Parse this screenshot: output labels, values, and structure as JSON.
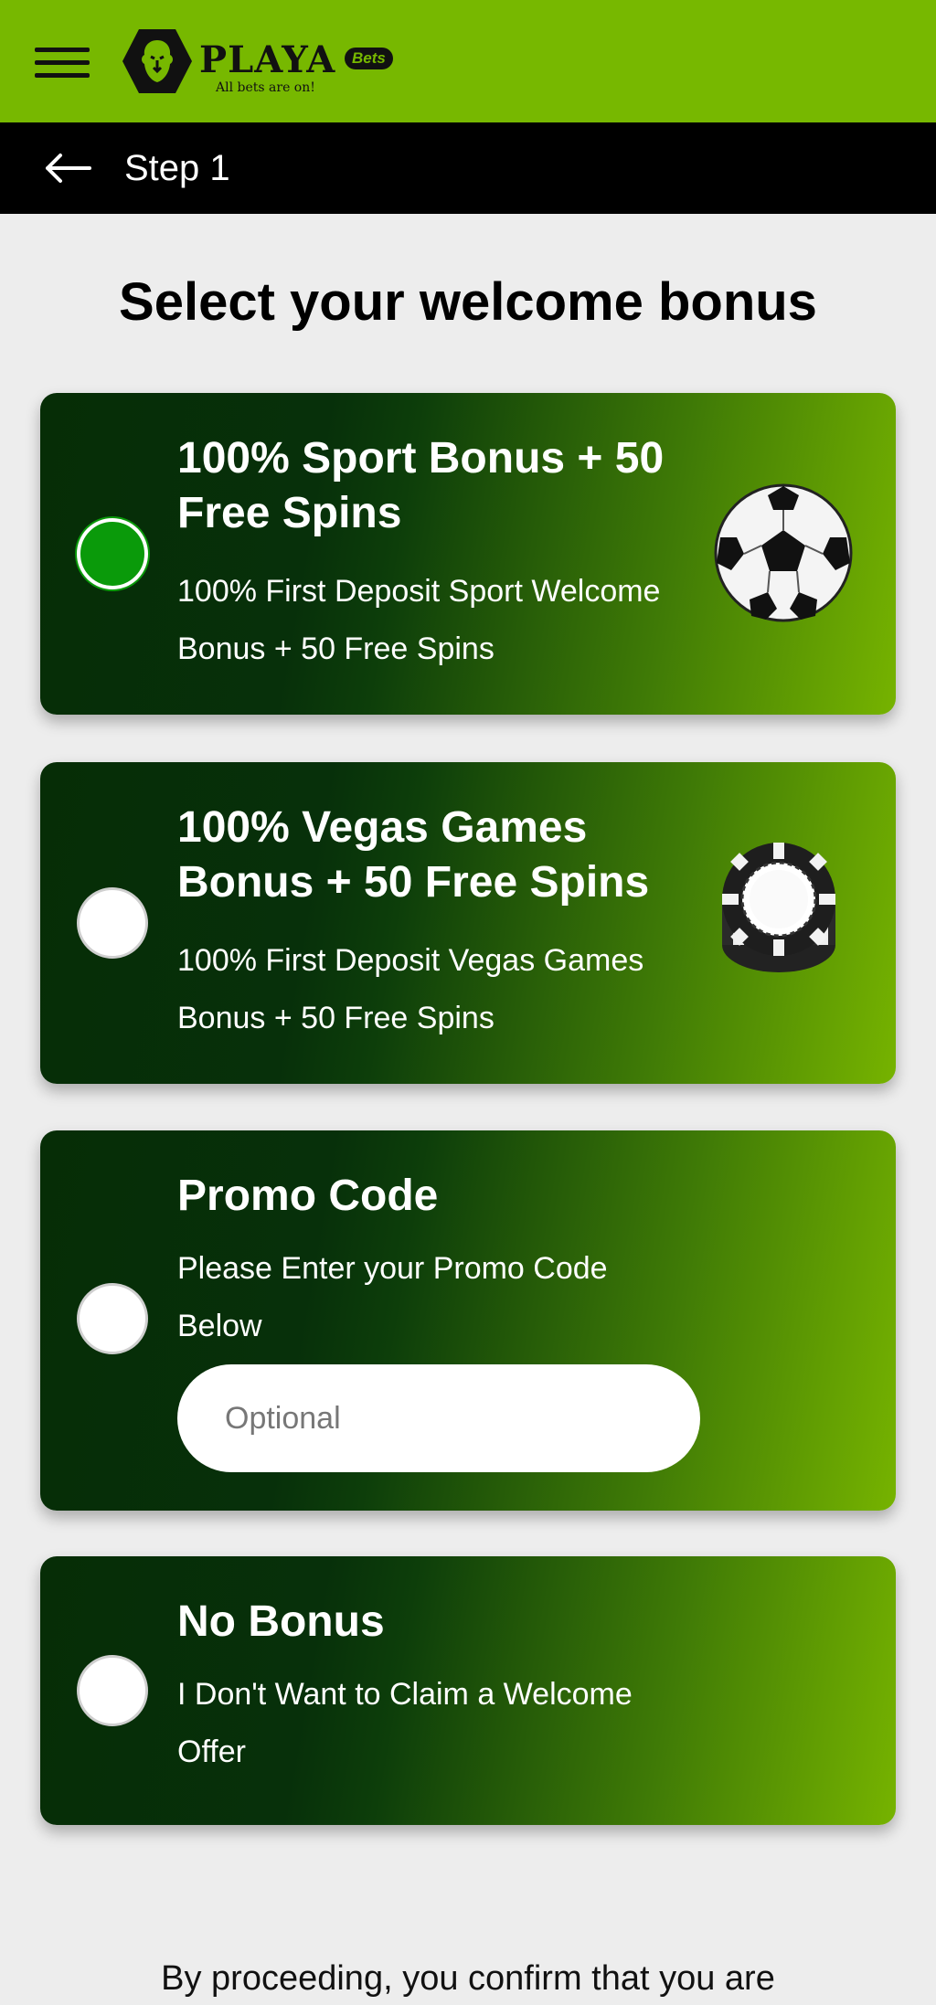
{
  "header": {
    "logo_word": "PLAYA",
    "logo_badge": "Bets",
    "logo_tagline": "All bets are on!",
    "menu_icon": "hamburger-menu-icon",
    "brand_color": "#77b800"
  },
  "step_bar": {
    "back_icon": "arrow-left-icon",
    "title": "Step 1"
  },
  "page": {
    "heading": "Select your welcome bonus"
  },
  "bonus_options": [
    {
      "title_line1": "100% Sport Bonus + 50",
      "title_line2": "Free Spins",
      "desc_line1": "100% First Deposit Sport Welcome",
      "desc_line2": "Bonus + 50 Free Spins",
      "selected": true,
      "icon": "soccer-ball-icon"
    },
    {
      "title_line1": "100% Vegas Games",
      "title_line2": "Bonus + 50 Free Spins",
      "desc_line1": "100% First Deposit Vegas Games",
      "desc_line2": "Bonus + 50 Free Spins",
      "selected": false,
      "icon": "casino-chip-icon"
    },
    {
      "title_line1": "Promo Code",
      "desc_line1": "Please Enter your Promo Code",
      "desc_line2": "Below",
      "input_placeholder": "Optional",
      "selected": false
    },
    {
      "title_line1": "No Bonus",
      "desc_line1": "I Don't Want to Claim a Welcome",
      "desc_line2": "Offer",
      "selected": false
    }
  ],
  "footer": {
    "text": "By proceeding, you confirm that you are"
  }
}
